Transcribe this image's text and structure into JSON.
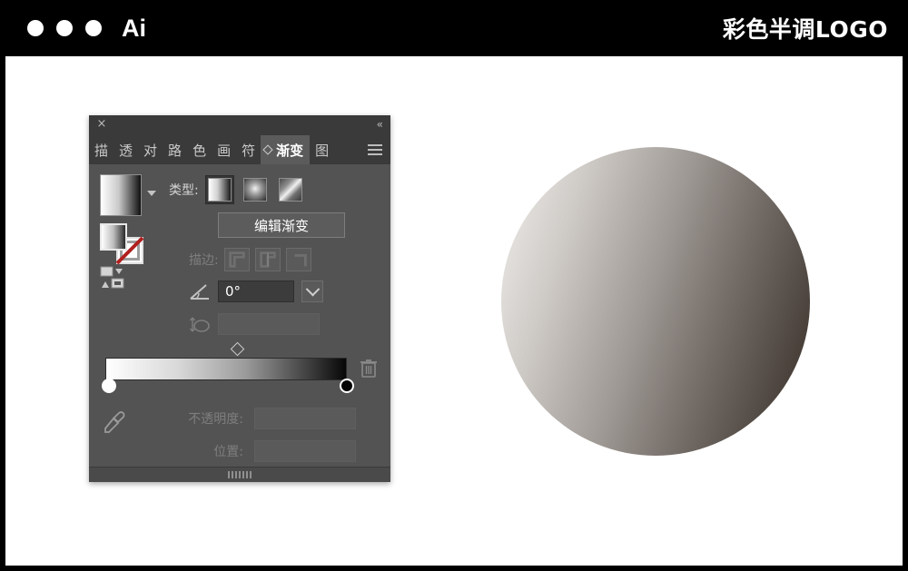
{
  "window": {
    "app_mark": "Ai",
    "title_right": "彩色半调LOGO",
    "traffic_lights": [
      "close",
      "minimize",
      "maximize"
    ]
  },
  "panel": {
    "header": {
      "close_label": "×",
      "collapse_label": "«"
    },
    "tabs": [
      {
        "label": "描",
        "active": false
      },
      {
        "label": "透",
        "active": false
      },
      {
        "label": "对",
        "active": false
      },
      {
        "label": "路",
        "active": false
      },
      {
        "label": "色",
        "active": false
      },
      {
        "label": "画",
        "active": false
      },
      {
        "label": "符",
        "active": false
      },
      {
        "label": "渐变",
        "active": true
      },
      {
        "label": "图",
        "active": false,
        "truncated": true
      }
    ],
    "menu_icon": "hamburger-menu-icon",
    "swatches": {
      "gradient_preview": "white-to-black-linear-gradient",
      "fill": "gradient-fill",
      "stroke": "none-stroke",
      "fill_type_icon": "fill-stroke-toggle-icon"
    },
    "type_row": {
      "label": "类型:",
      "options": [
        {
          "name": "线性渐变",
          "icon": "linear-gradient-icon",
          "selected": true
        },
        {
          "name": "径向渐变",
          "icon": "radial-gradient-icon",
          "selected": false
        },
        {
          "name": "任意形状渐变",
          "icon": "freeform-gradient-icon",
          "selected": false
        }
      ]
    },
    "edit_gradient_button": "编辑渐变",
    "stroke_row": {
      "label": "描边:",
      "disabled": true,
      "options": [
        {
          "name": "stroke-align-start-icon"
        },
        {
          "name": "stroke-align-center-icon"
        },
        {
          "name": "stroke-align-end-icon"
        }
      ]
    },
    "angle_row": {
      "icon": "angle-icon",
      "value": "0°",
      "disabled": false
    },
    "aspect_row": {
      "icon": "aspect-ratio-icon",
      "value": "",
      "disabled": true
    },
    "gradient_slider": {
      "start_color": "#ffffff",
      "end_color": "#000000",
      "midpoint_position": "50%",
      "delete_icon": "trash-icon"
    },
    "eyedropper_icon": "eyedropper-icon",
    "opacity_row": {
      "label": "不透明度:",
      "value": "",
      "disabled": true
    },
    "location_row": {
      "label": "位置:",
      "value": "",
      "disabled": true
    },
    "footer": {
      "grip": "resize-grip"
    }
  },
  "artwork": {
    "shape": "circle",
    "gradient_from": "#ece9e7",
    "gradient_to": "#382f28",
    "gradient_angle": "108deg"
  }
}
